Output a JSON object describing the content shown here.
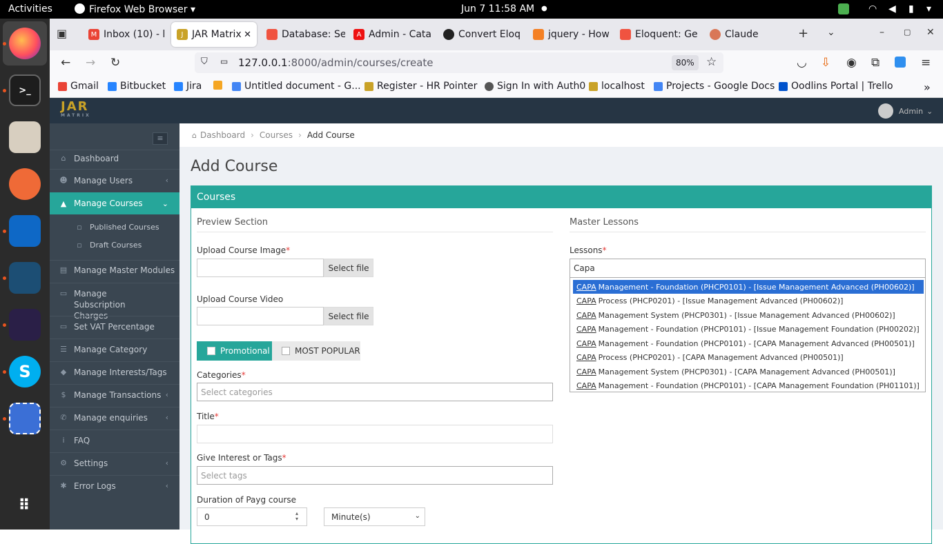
{
  "os": {
    "activities": "Activities",
    "app_name": "Firefox Web Browser",
    "clock": "Jun 7  11:58 AM"
  },
  "browser": {
    "tabs": [
      {
        "label": "Inbox (10) - h",
        "icon": "gmail-icon"
      },
      {
        "label": "JAR Matrix",
        "icon": "jar-icon"
      },
      {
        "label": "Database: Se",
        "icon": "laravel-icon"
      },
      {
        "label": "Admin - Cata",
        "icon": "adobe-icon"
      },
      {
        "label": "Convert Eloq",
        "icon": "openai-icon"
      },
      {
        "label": "jquery - How",
        "icon": "stackoverflow-icon"
      },
      {
        "label": "Eloquent: Ge",
        "icon": "laravel-icon"
      },
      {
        "label": "Claude",
        "icon": "claude-icon"
      }
    ],
    "url_host": "127.0.0.1",
    "url_rest": ":8000/admin/courses/create",
    "zoom": "80%",
    "bookmarks": [
      {
        "label": "Gmail",
        "color": "#ea4335"
      },
      {
        "label": "Bitbucket",
        "color": "#2684ff"
      },
      {
        "label": "Jira",
        "color": "#2684ff"
      },
      {
        "label": "",
        "color": "#f5a623"
      },
      {
        "label": "Untitled document - G...",
        "color": "#4285f4"
      },
      {
        "label": "Register - HR Pointer",
        "color": "#c9a227"
      },
      {
        "label": "Sign In with Auth0",
        "color": "#555555"
      },
      {
        "label": "localhost",
        "color": "#c9a227"
      },
      {
        "label": "Projects - Google Docs",
        "color": "#4285f4"
      },
      {
        "label": "Oodlins Portal | Trello",
        "color": "#0052cc"
      }
    ]
  },
  "app": {
    "logo": "JAR",
    "logo_sub": "MATRIX",
    "user": "Admin",
    "sidebar": [
      {
        "label": "Dashboard",
        "icon": "home-icon",
        "chevron": false
      },
      {
        "label": "Manage Users",
        "icon": "users-icon",
        "chevron": true
      },
      {
        "label": "Manage Courses",
        "icon": "graduation-cap-icon",
        "chevron": true,
        "active": true
      },
      {
        "label": "Published Courses",
        "icon": "file-icon",
        "sub": true
      },
      {
        "label": "Draft Courses",
        "icon": "file-icon",
        "sub": true
      },
      {
        "label": "Manage Master Modules",
        "icon": "book-icon",
        "chevron": true
      },
      {
        "label": "Manage Subscription Charges",
        "icon": "money-icon",
        "chevron": false
      },
      {
        "label": "Set VAT Percentage",
        "icon": "money-icon",
        "chevron": false
      },
      {
        "label": "Manage Category",
        "icon": "list-icon",
        "chevron": false
      },
      {
        "label": "Manage Interests/Tags",
        "icon": "tag-icon",
        "chevron": false
      },
      {
        "label": "Manage Transactions",
        "icon": "dollar-icon",
        "chevron": true
      },
      {
        "label": "Manage enquiries",
        "icon": "phone-icon",
        "chevron": true
      },
      {
        "label": "FAQ",
        "icon": "info-icon",
        "chevron": false
      },
      {
        "label": "Settings",
        "icon": "gears-icon",
        "chevron": true
      },
      {
        "label": "Error Logs",
        "icon": "bug-icon",
        "chevron": true
      }
    ],
    "breadcrumb": [
      "Dashboard",
      "Courses",
      "Add Course"
    ],
    "page_title": "Add Course",
    "panel_title": "Courses",
    "preview_section": "Preview Section",
    "master_lessons": "Master Lessons",
    "upload_image_label": "Upload Course Image",
    "upload_video_label": "Upload Course Video",
    "select_file": "Select file",
    "promotional": "Promotional",
    "most_popular": "MOST POPULAR",
    "categories_label": "Categories",
    "categories_placeholder": "Select categories",
    "title_label": "Title",
    "tags_label": "Give Interest or Tags",
    "tags_placeholder": "Select tags",
    "duration_label": "Duration of Payg course",
    "duration_value": "0",
    "duration_unit": "Minute(s)",
    "lessons_label": "Lessons",
    "lessons_query": "Capa",
    "lesson_options": [
      {
        "match": "CAPA",
        "rest": "Management - Foundation (PHCP0101) - [Issue Management Advanced (PH00602)]"
      },
      {
        "match": "CAPA",
        "rest": "Process (PHCP0201) - [Issue Management Advanced (PH00602)]"
      },
      {
        "match": "CAPA",
        "rest": "Management System (PHCP0301) - [Issue Management Advanced (PH00602)]"
      },
      {
        "match": "CAPA",
        "rest": "Management - Foundation (PHCP0101) - [Issue Management Foundation (PH00202)]"
      },
      {
        "match": "CAPA",
        "rest": "Management - Foundation (PHCP0101) - [CAPA Management Advanced (PH00501)]"
      },
      {
        "match": "CAPA",
        "rest": "Process (PHCP0201) - [CAPA Management Advanced (PH00501)]"
      },
      {
        "match": "CAPA",
        "rest": "Management System (PHCP0301) - [CAPA Management Advanced (PH00501)]"
      },
      {
        "match": "CAPA",
        "rest": "Management - Foundation (PHCP0101) - [CAPA Management Foundation (PH01101)]"
      }
    ]
  }
}
